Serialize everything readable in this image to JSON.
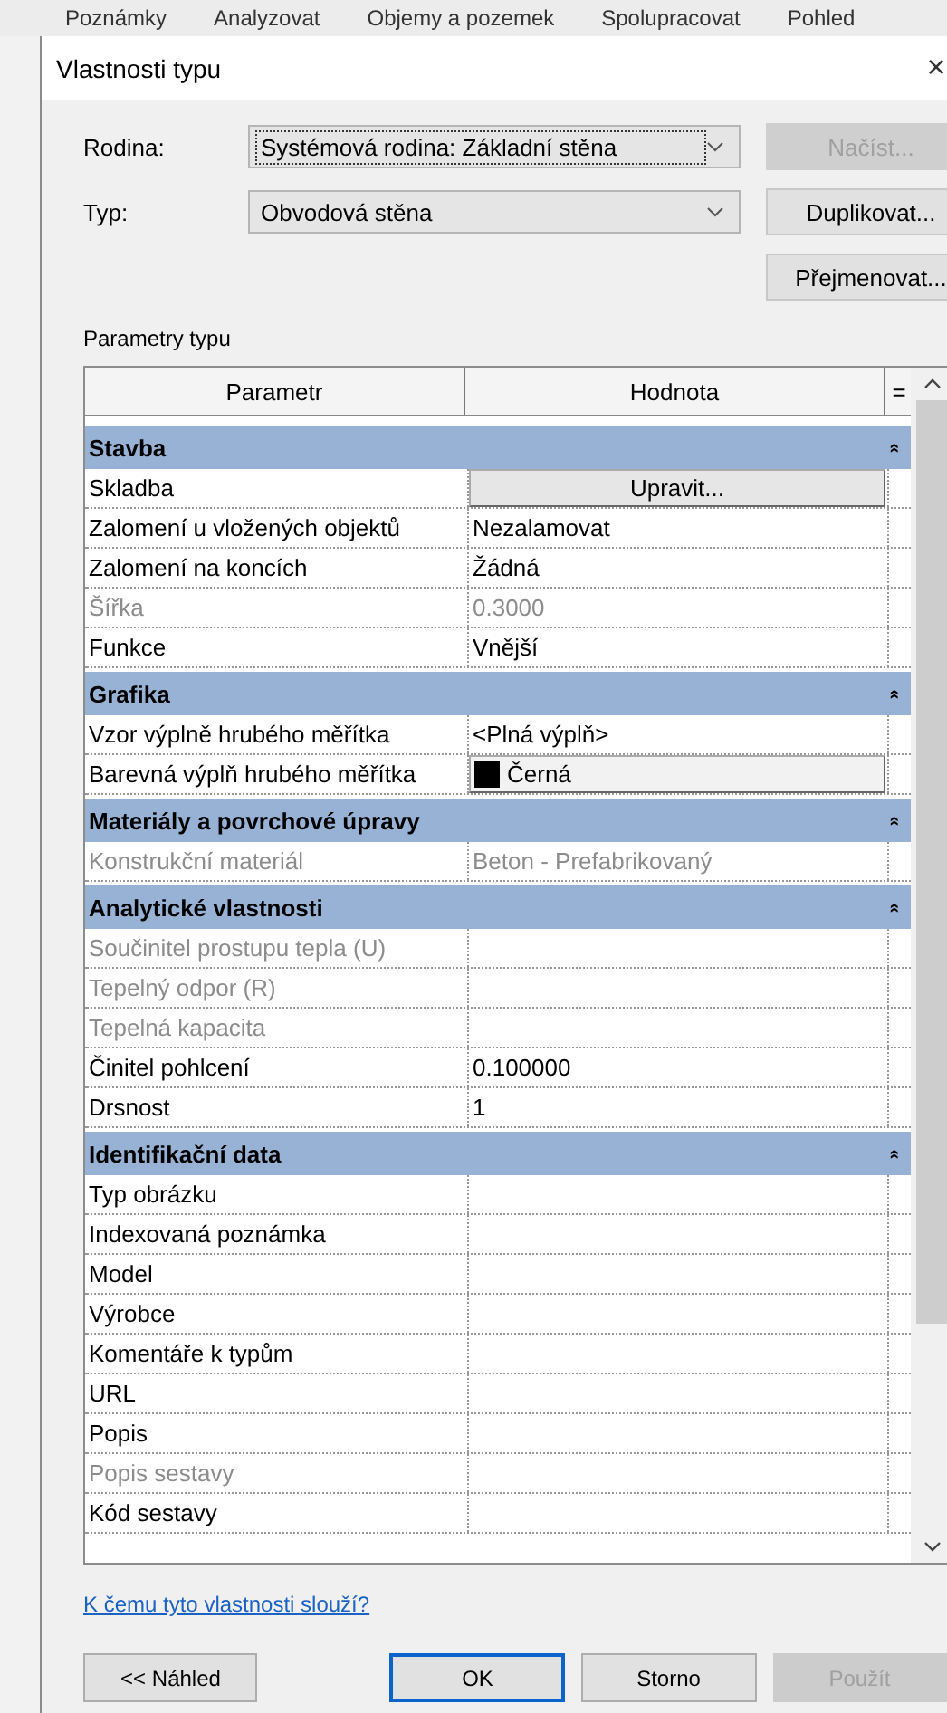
{
  "background_menu": [
    "Poznámky",
    "Analyzovat",
    "Objemy a pozemek",
    "Spolupracovat",
    "Pohled"
  ],
  "window": {
    "title": "Vlastnosti typu",
    "close": "×"
  },
  "form": [
    {
      "label": "Rodina:",
      "value": "Systémová rodina: Základní stěna",
      "focused": true,
      "button": {
        "label": "Načíst...",
        "disabled": true
      }
    },
    {
      "label": "Typ:",
      "value": "Obvodová stěna",
      "focused": false,
      "button": {
        "label": "Duplikovat...",
        "disabled": false
      }
    }
  ],
  "rename_button": "Přejmenovat...",
  "section_label": "Parametry typu",
  "table": {
    "columns": [
      "Parametr",
      "Hodnota",
      "="
    ],
    "rows": [
      {
        "kind": "section",
        "name": "Stavba",
        "collapse": "»"
      },
      {
        "kind": "button",
        "name": "Skladba",
        "value": "Upravit...",
        "disabled": false
      },
      {
        "kind": "text",
        "name": "Zalomení u vložených objektů",
        "value": "Nezalamovat",
        "disabled": false
      },
      {
        "kind": "text",
        "name": "Zalomení na koncích",
        "value": "Žádná",
        "disabled": false
      },
      {
        "kind": "text",
        "name": "Šířka",
        "value": "0.3000",
        "disabled": true
      },
      {
        "kind": "text",
        "name": "Funkce",
        "value": "Vnější",
        "disabled": false
      },
      {
        "kind": "section",
        "name": "Grafika",
        "collapse": "»"
      },
      {
        "kind": "text",
        "name": "Vzor výplně hrubého měřítka",
        "value": "<Plná výplň>",
        "disabled": false
      },
      {
        "kind": "color",
        "name": "Barevná výplň hrubého měřítka",
        "value": "Černá",
        "disabled": false
      },
      {
        "kind": "section",
        "name": "Materiály a povrchové úpravy",
        "collapse": "»"
      },
      {
        "kind": "text",
        "name": "Konstrukční materiál",
        "value": "Beton - Prefabrikovaný",
        "disabled": true
      },
      {
        "kind": "section",
        "name": "Analytické vlastnosti",
        "collapse": "»"
      },
      {
        "kind": "text",
        "name": "Součinitel prostupu tepla (U)",
        "disabled": true
      },
      {
        "kind": "text",
        "name": "Tepelný odpor (R)",
        "disabled": true
      },
      {
        "kind": "text",
        "name": "Tepelná kapacita",
        "disabled": true
      },
      {
        "kind": "text",
        "name": "Činitel pohlcení",
        "value": "0.100000",
        "disabled": false
      },
      {
        "kind": "text",
        "name": "Drsnost",
        "value": "1",
        "disabled": false
      },
      {
        "kind": "section",
        "name": "Identifikační data",
        "collapse": "»"
      },
      {
        "kind": "text",
        "name": "Typ obrázku",
        "disabled": false
      },
      {
        "kind": "text",
        "name": "Indexovaná poznámka",
        "disabled": false
      },
      {
        "kind": "text",
        "name": "Model",
        "disabled": false
      },
      {
        "kind": "text",
        "name": "Výrobce",
        "disabled": false
      },
      {
        "kind": "text",
        "name": "Komentáře k typům",
        "disabled": false
      },
      {
        "kind": "text",
        "name": "URL",
        "disabled": false
      },
      {
        "kind": "text",
        "name": "Popis",
        "disabled": false
      },
      {
        "kind": "text",
        "name": "Popis sestavy",
        "disabled": true
      },
      {
        "kind": "text",
        "name": "Kód sestavy",
        "disabled": false
      }
    ]
  },
  "help_link": "K čemu tyto vlastnosti slouží?",
  "buttons": [
    {
      "label": "<< Náhled",
      "default": false,
      "disabled": false
    },
    {
      "label": "OK",
      "default": true,
      "disabled": false
    },
    {
      "label": "Storno",
      "default": false,
      "disabled": false
    },
    {
      "label": "Použít",
      "default": false,
      "disabled": true
    }
  ]
}
